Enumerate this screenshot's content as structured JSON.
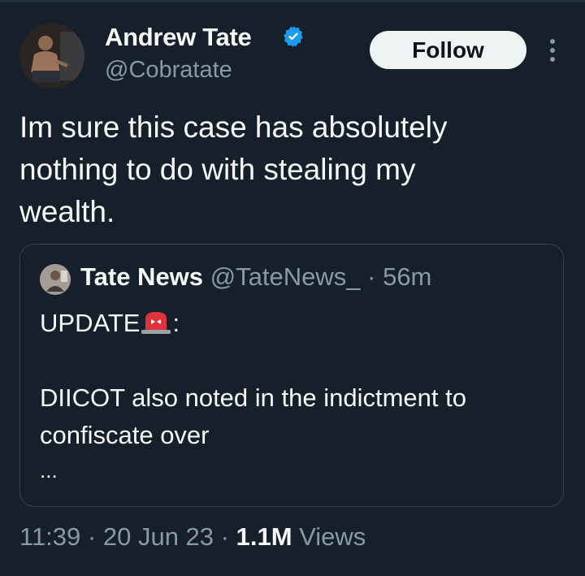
{
  "author": {
    "name": "Andrew Tate",
    "handle": "@Cobratate",
    "verified_color": "#1d9bf0"
  },
  "follow_button": {
    "label": "Follow"
  },
  "more_menu": {
    "icon": "more-vertical-icon"
  },
  "tweet": {
    "lines": [
      "Im sure this case has absolutely",
      "nothing to do with stealing my",
      "wealth."
    ]
  },
  "quote": {
    "name": "Tate News",
    "handle": "@TateNews_",
    "separator": "·",
    "time": "56m",
    "update_label": "UPDATE",
    "siren_icon": "police-light-emoji",
    "colon": ":",
    "lines": [
      "DIICOT also noted in the indictment to",
      "confiscate over"
    ],
    "ellipsis": "..."
  },
  "meta": {
    "time": "11:39",
    "sep1": "·",
    "date": "20 Jun 23",
    "sep2": "·",
    "views_count": "1.1M",
    "views_label": "Views"
  },
  "colors": {
    "background": "#15202b",
    "text_primary": "#f7f9f9",
    "text_secondary": "#8b98a5",
    "border": "#38444d",
    "follow_bg": "#eff3f4"
  }
}
